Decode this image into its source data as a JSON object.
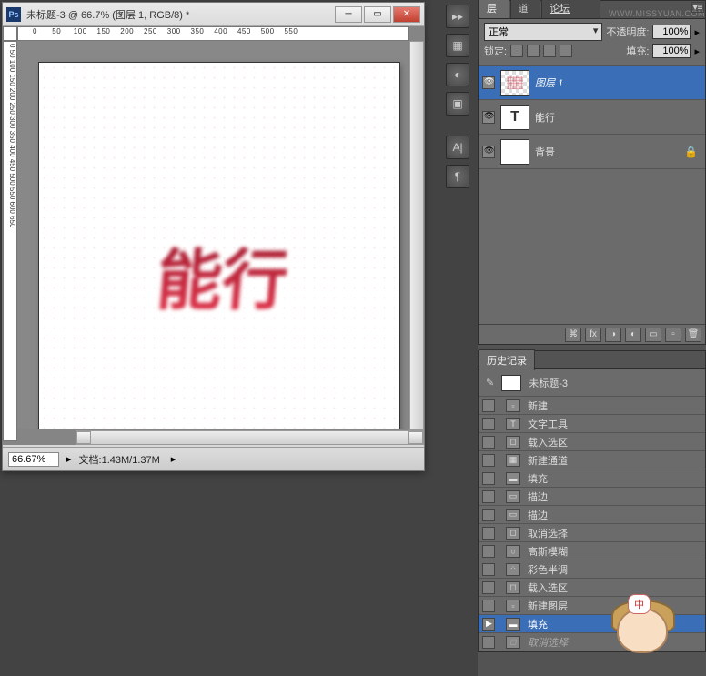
{
  "document": {
    "title": "未标题-3 @ 66.7% (图层 1, RGB/8) *",
    "zoom": "66.67%",
    "info": "文档:1.43M/1.37M",
    "canvas_text": "能行"
  },
  "toolstrip": {
    "icons": [
      "layers-group-icon",
      "adjustments-icon",
      "masks-icon",
      "divider",
      "character-icon",
      "paragraph-icon"
    ]
  },
  "layers_panel": {
    "tabs": {
      "layers": "图层",
      "channels": "通道",
      "forum_link": "思缘设计论坛"
    },
    "watermark": "WWW.MISSYUAN.COM",
    "blend_mode": "正常",
    "opacity_label": "不透明度:",
    "opacity_value": "100%",
    "lock_label": "锁定:",
    "fill_label": "填充:",
    "fill_value": "100%",
    "layers": [
      {
        "name": "图层 1",
        "selected": true,
        "thumb": "checker",
        "visible": true
      },
      {
        "name": "能行",
        "selected": false,
        "thumb": "T",
        "visible": true
      },
      {
        "name": "背景",
        "selected": false,
        "thumb": "white",
        "visible": true,
        "locked": true
      }
    ],
    "footer_icons": [
      "link-icon",
      "fx-icon",
      "mask-icon",
      "adjustment-icon",
      "group-icon",
      "new-layer-icon",
      "trash-icon"
    ]
  },
  "history_panel": {
    "title": "历史记录",
    "doc_name": "未标题-3",
    "steps": [
      {
        "label": "新建",
        "icon": "doc"
      },
      {
        "label": "文字工具",
        "icon": "T"
      },
      {
        "label": "载入选区",
        "icon": "sel"
      },
      {
        "label": "新建通道",
        "icon": "ch"
      },
      {
        "label": "填充",
        "icon": "fill"
      },
      {
        "label": "描边",
        "icon": "str"
      },
      {
        "label": "描边",
        "icon": "str"
      },
      {
        "label": "取消选择",
        "icon": "sel"
      },
      {
        "label": "高斯模糊",
        "icon": "fx"
      },
      {
        "label": "彩色半调",
        "icon": "fx"
      },
      {
        "label": "载入选区",
        "icon": "sel"
      },
      {
        "label": "新建图层",
        "icon": "lay"
      },
      {
        "label": "填充",
        "icon": "fill",
        "selected": true
      },
      {
        "label": "取消选择",
        "icon": "sel",
        "dim": true
      }
    ]
  },
  "mascot": {
    "bubble_text": "中"
  }
}
